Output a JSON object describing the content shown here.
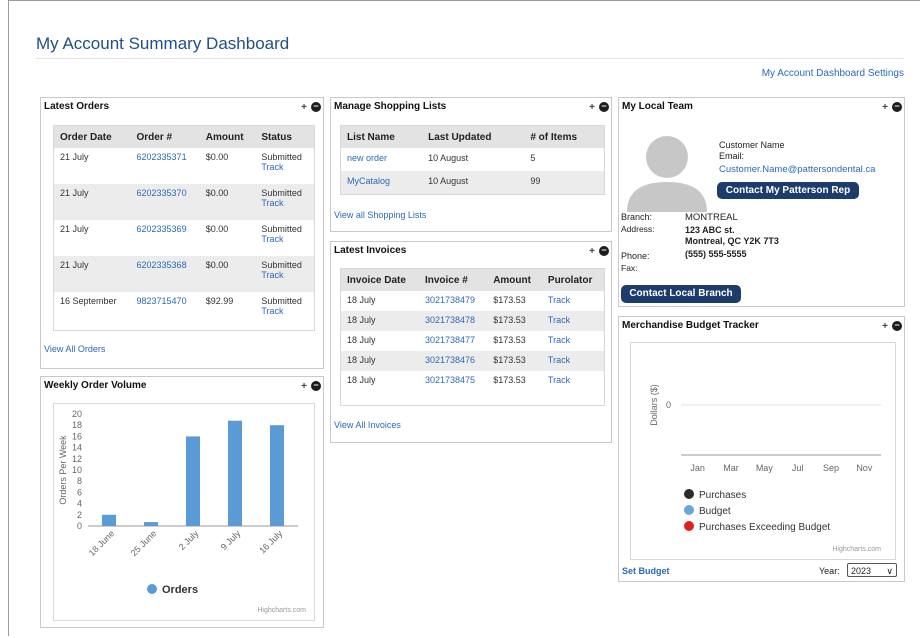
{
  "page": {
    "title": "My Account Summary Dashboard",
    "settings_link": "My Account Dashboard Settings"
  },
  "latest_orders": {
    "title": "Latest Orders",
    "columns": [
      "Order Date",
      "Order #",
      "Amount",
      "Status"
    ],
    "rows": [
      {
        "date": "21 July",
        "order": "6202335371",
        "amount": "$0.00",
        "status": "Submitted",
        "track": "Track"
      },
      {
        "date": "21 July",
        "order": "6202335370",
        "amount": "$0.00",
        "status": "Submitted",
        "track": "Track"
      },
      {
        "date": "21 July",
        "order": "6202335369",
        "amount": "$0.00",
        "status": "Submitted",
        "track": "Track"
      },
      {
        "date": "21 July",
        "order": "6202335368",
        "amount": "$0.00",
        "status": "Submitted",
        "track": "Track"
      },
      {
        "date": "16 September",
        "order": "9823715470",
        "amount": "$92.99",
        "status": "Submitted",
        "track": "Track"
      }
    ],
    "view_all": "View All Orders"
  },
  "shopping_lists": {
    "title": "Manage Shopping Lists",
    "columns": [
      "List Name",
      "Last Updated",
      "# of Items"
    ],
    "rows": [
      {
        "name": "new order",
        "updated": "10 August",
        "items": "5"
      },
      {
        "name": "MyCatalog",
        "updated": "10 August",
        "items": "99"
      }
    ],
    "view_all": "View all Shopping Lists"
  },
  "invoices": {
    "title": "Latest Invoices",
    "columns": [
      "Invoice Date",
      "Invoice #",
      "Amount",
      "Purolator"
    ],
    "rows": [
      {
        "date": "18 July",
        "invoice": "3021738479",
        "amount": "$173.53",
        "track": "Track"
      },
      {
        "date": "18 July",
        "invoice": "3021738478",
        "amount": "$173.53",
        "track": "Track"
      },
      {
        "date": "18 July",
        "invoice": "3021738477",
        "amount": "$173.53",
        "track": "Track"
      },
      {
        "date": "18 July",
        "invoice": "3021738476",
        "amount": "$173.53",
        "track": "Track"
      },
      {
        "date": "18 July",
        "invoice": "3021738475",
        "amount": "$173.53",
        "track": "Track"
      }
    ],
    "view_all": "View All Invoices"
  },
  "local_team": {
    "title": "My Local Team",
    "customer_name": "Customer Name",
    "email_label": "Email:",
    "email": "Customer.Name@pattersondental.ca",
    "contact_rep": "Contact My Patterson Rep",
    "branch_label": "Branch:",
    "branch": "MONTREAL",
    "address_label": "Address:",
    "address1": "123 ABC st.",
    "address2": "Montreal, QC Y2K 7T3",
    "phone_label": "Phone:",
    "phone": "(555) 555-5555",
    "fax_label": "Fax:",
    "contact_branch": "Contact Local Branch"
  },
  "budget": {
    "title": "Merchandise Budget Tracker",
    "set_budget": "Set Budget",
    "year_label": "Year:",
    "year": "2023",
    "credit": "Highcharts.com"
  },
  "weekly": {
    "title": "Weekly Order Volume",
    "credit": "Highcharts.com"
  },
  "controls": {
    "move": "+",
    "minimize": "−"
  },
  "colors": {
    "bar": "#5b9bd5",
    "purchases": "#2b2b2b",
    "budget": "#6aa6de",
    "exceeding": "#e02020",
    "button": "#1c3c6e",
    "link": "#2a6ab8"
  },
  "chart_data": [
    {
      "type": "bar",
      "categories": [
        "18 June",
        "25 June",
        "2 July",
        "9 July",
        "16 July"
      ],
      "series": [
        {
          "name": "Orders",
          "values": [
            2,
            0.7,
            16,
            18.8,
            18
          ]
        }
      ],
      "ylabel": "Orders Per Week",
      "ylim": [
        0,
        20
      ],
      "yticks": [
        0,
        2,
        4,
        6,
        8,
        10,
        12,
        14,
        16,
        18,
        20
      ],
      "legend": "bottom"
    },
    {
      "type": "line",
      "categories": [
        "Jan",
        "Mar",
        "May",
        "Jul",
        "Sep",
        "Nov"
      ],
      "series": [
        {
          "name": "Purchases",
          "values": []
        },
        {
          "name": "Budget",
          "values": []
        },
        {
          "name": "Purchases Exceeding Budget",
          "values": []
        }
      ],
      "ylabel": "Dollars ($)",
      "yticks": [
        0
      ],
      "legend": "bottom"
    }
  ]
}
